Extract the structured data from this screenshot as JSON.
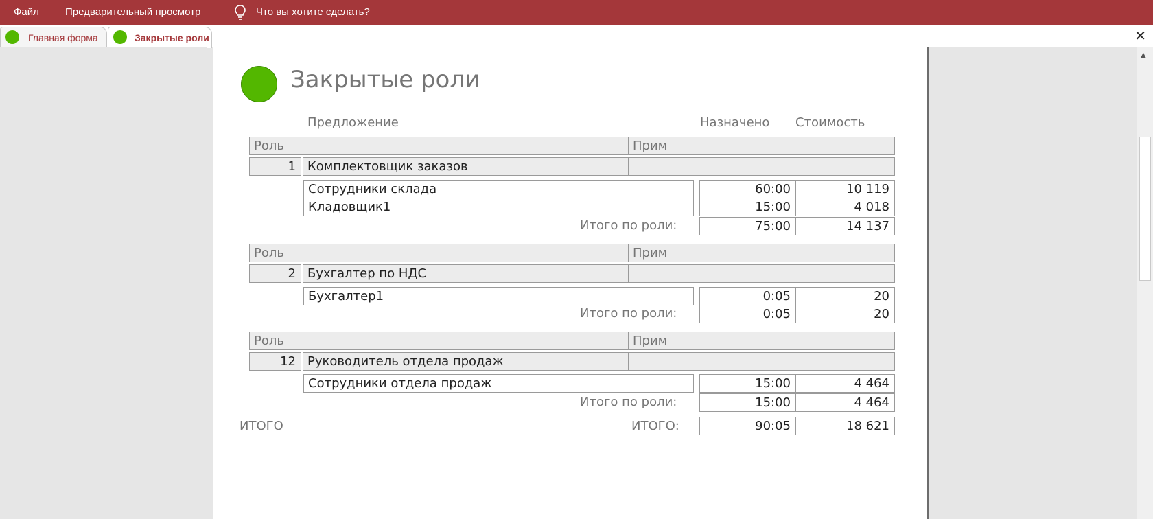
{
  "ribbon": {
    "file": "Файл",
    "preview": "Предварительный просмотр",
    "tell_me": "Что вы хотите сделать?"
  },
  "tabs": [
    {
      "label": "Главная форма"
    },
    {
      "label": "Закрытые роли"
    }
  ],
  "report": {
    "title": "Закрытые роли",
    "columns": {
      "offer": "Предложение",
      "assigned": "Назначено",
      "cost": "Стоимость"
    },
    "group_header": {
      "role": "Роль",
      "note": "Прим"
    },
    "subtotal_label": "Итого по роли:",
    "groups": [
      {
        "id": "1",
        "name": "Комплектовщик заказов",
        "note": "",
        "rows": [
          {
            "offer": "Сотрудники склада",
            "assigned": "60:00",
            "cost": "10 119"
          },
          {
            "offer": "Кладовщик1",
            "assigned": "15:00",
            "cost": "4 018"
          }
        ],
        "subtotal": {
          "assigned": "75:00",
          "cost": "14 137"
        }
      },
      {
        "id": "2",
        "name": "Бухгалтер по НДС",
        "note": "",
        "rows": [
          {
            "offer": "Бухгалтер1",
            "assigned": "0:05",
            "cost": "20"
          }
        ],
        "subtotal": {
          "assigned": "0:05",
          "cost": "20"
        }
      },
      {
        "id": "12",
        "name": "Руководитель отдела продаж",
        "note": "",
        "rows": [
          {
            "offer": "Сотрудники отдела продаж",
            "assigned": "15:00",
            "cost": "4 464"
          }
        ],
        "subtotal": {
          "assigned": "15:00",
          "cost": "4 464"
        }
      }
    ],
    "total": {
      "left_label": "ИТОГО",
      "right_label": "ИТОГО:",
      "assigned": "90:05",
      "cost": "18 621"
    }
  },
  "icons": {
    "tab_icon": "green-circle-icon",
    "tell_me_icon": "lightbulb-icon",
    "close": "close-icon",
    "report_icon": "green-circle-icon"
  },
  "colors": {
    "ribbon": "#a4373a",
    "accent_green": "#53b700"
  }
}
